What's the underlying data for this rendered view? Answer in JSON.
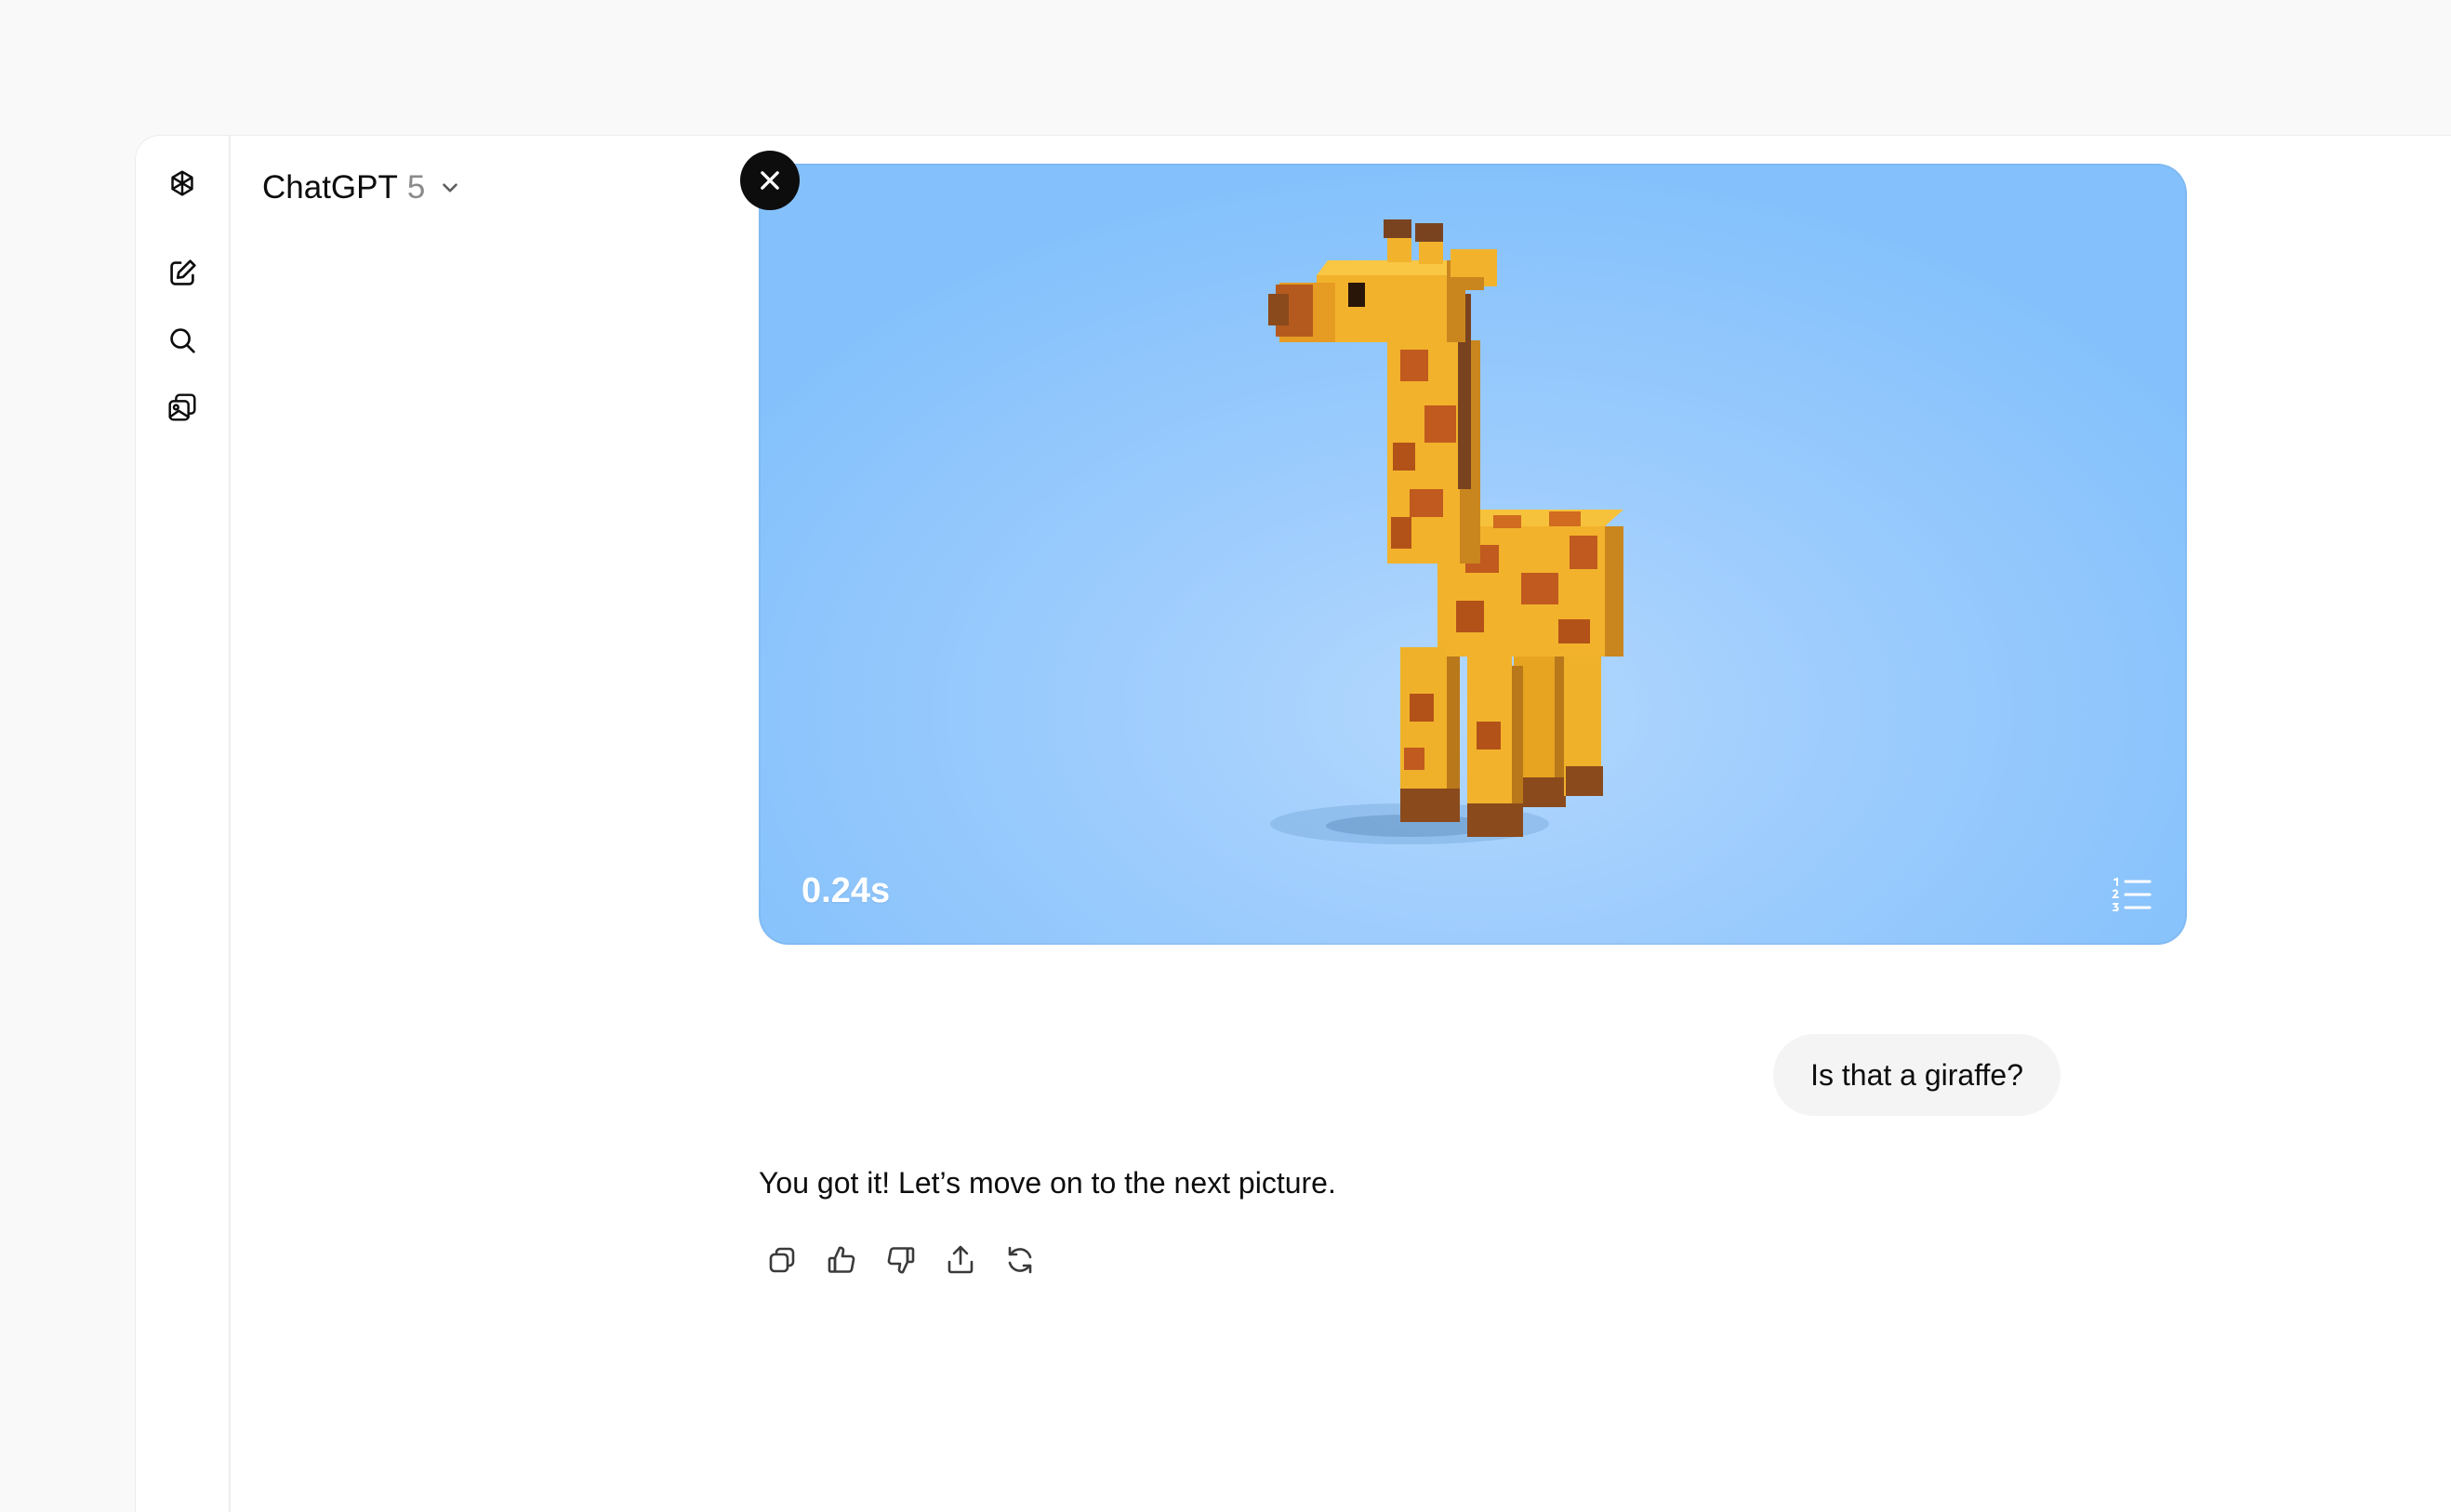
{
  "header": {
    "model_name": "ChatGPT",
    "model_version": "5"
  },
  "sidebar": {
    "items": [
      {
        "icon": "openai-logo-icon"
      },
      {
        "icon": "new-chat-icon"
      },
      {
        "icon": "search-icon"
      },
      {
        "icon": "library-icon"
      }
    ]
  },
  "media": {
    "timer": "0.24s",
    "subject": "voxel giraffe",
    "background_color": "#9fcdfd"
  },
  "messages": {
    "user": "Is that a giraffe?",
    "assistant": "You got it! Let’s move on to the next picture."
  },
  "actions": [
    "copy-icon",
    "thumbs-up-icon",
    "thumbs-down-icon",
    "share-icon",
    "regenerate-icon"
  ],
  "colors": {
    "accent": "#0d0d0d",
    "bubble": "#f4f4f4"
  }
}
